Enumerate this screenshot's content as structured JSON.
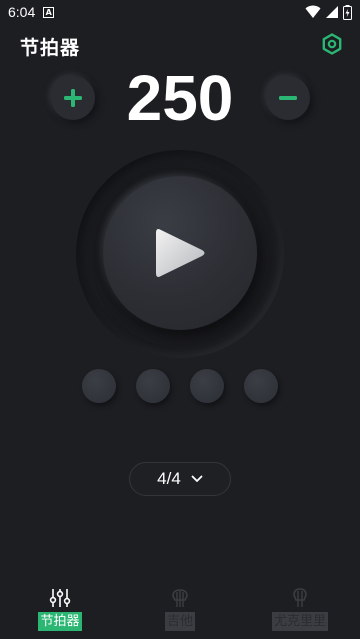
{
  "status_bar": {
    "time": "6:04",
    "notification_badge": "A"
  },
  "header": {
    "title": "节拍器",
    "settings_icon": "gear-icon"
  },
  "bpm": {
    "value": "250",
    "increase_icon": "plus-icon",
    "decrease_icon": "minus-icon"
  },
  "player": {
    "play_icon": "play-icon"
  },
  "beats": {
    "count": 4
  },
  "time_signature": {
    "value": "4/4",
    "dropdown_icon": "chevron-down-icon"
  },
  "nav": {
    "items": [
      {
        "label": "节拍器",
        "icon": "sliders-icon",
        "active": true
      },
      {
        "label": "吉他",
        "icon": "guitar-icon",
        "active": false
      },
      {
        "label": "尤克里里",
        "icon": "ukulele-icon",
        "active": false
      }
    ]
  },
  "colors": {
    "accent": "#2bb673",
    "background": "#1d1e22"
  }
}
